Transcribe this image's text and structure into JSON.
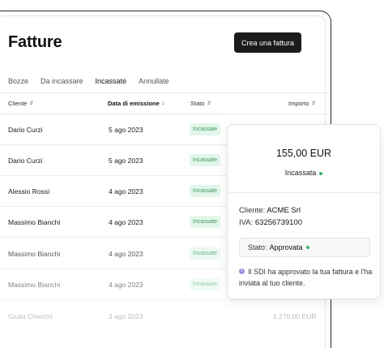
{
  "header": {
    "title": "Fatture",
    "create_button": "Crea una fattura"
  },
  "tabs": [
    "Bozze",
    "Da incassare",
    "Incassate",
    "Annullate"
  ],
  "active_tab": "Incassate",
  "table": {
    "columns": {
      "client": "Cliente",
      "date": "Data di emissione",
      "status": "Stato",
      "amount": "Importo"
    },
    "rows": [
      {
        "client": "Dario Curzi",
        "date": "5 ago 2023",
        "status": "Incassate",
        "amount": ""
      },
      {
        "client": "Dario Curzi",
        "date": "5 ago 2023",
        "status": "Incassate",
        "amount": ""
      },
      {
        "client": "Alessio Rossi",
        "date": "4 ago 2023",
        "status": "Incassate",
        "amount": ""
      },
      {
        "client": "Massimo Bianchi",
        "date": "4 ago 2023",
        "status": "Incassate",
        "amount": ""
      },
      {
        "client": "Massimo Bianchi",
        "date": "4 ago 2023",
        "status": "Incassate",
        "amount": ""
      },
      {
        "client": "Massimo Bianchi",
        "date": "4 ago 2023",
        "status": "Incassate",
        "amount": ""
      },
      {
        "client": "Giulia Checchi",
        "date": "3 ago 2023",
        "status": "",
        "amount": "1.270,00 EUR"
      }
    ]
  },
  "popup": {
    "amount": "155,00 EUR",
    "state": "Incassata",
    "client_label": "Cliente:",
    "client_value": "ACME Srl",
    "vat_label": "IVA:",
    "vat_value": "63256739100",
    "sdi_label": "Stato:",
    "sdi_value": "Approvata",
    "info": "Il SDI ha approvato la tua fattura e l'ha inviata al tuo cliente."
  },
  "colors": {
    "status_bg": "#e3f6ea",
    "status_text": "#3e9a63",
    "dot": "#35b36d",
    "info_icon": "#9a8ce0"
  }
}
